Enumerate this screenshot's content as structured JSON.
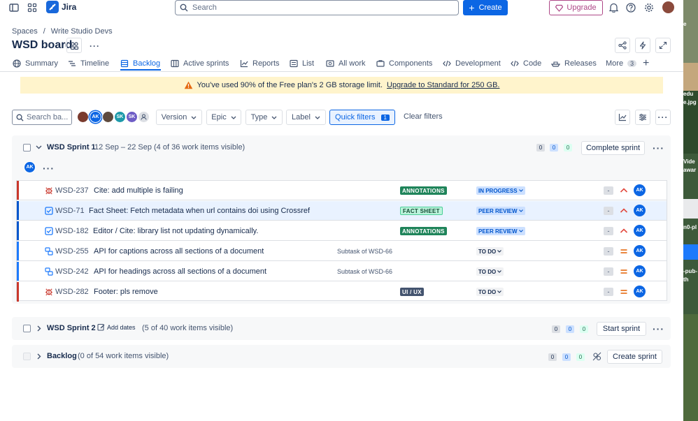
{
  "topbar": {
    "app_name": "Jira",
    "search_placeholder": "Search",
    "create_label": "Create",
    "upgrade_label": "Upgrade"
  },
  "header": {
    "breadcrumb": [
      "Spaces",
      "/",
      "Write Studio Devs"
    ],
    "title": "WSD board"
  },
  "tabs": [
    {
      "label": "Summary",
      "icon": "globe-icon"
    },
    {
      "label": "Timeline",
      "icon": "timeline-icon"
    },
    {
      "label": "Backlog",
      "icon": "backlog-icon",
      "active": true
    },
    {
      "label": "Active sprints",
      "icon": "board-icon"
    },
    {
      "label": "Reports",
      "icon": "chart-icon"
    },
    {
      "label": "List",
      "icon": "list-icon"
    },
    {
      "label": "All work",
      "icon": "all-work-icon"
    },
    {
      "label": "Components",
      "icon": "component-icon"
    },
    {
      "label": "Development",
      "icon": "code-icon"
    },
    {
      "label": "Code",
      "icon": "code-icon"
    },
    {
      "label": "Releases",
      "icon": "ship-icon"
    },
    {
      "label": "More",
      "icon": "",
      "count": "3"
    }
  ],
  "banner": {
    "text": "You've used 90% of the Free plan's 2 GB storage limit.",
    "link": "Upgrade to Standard for 250 GB."
  },
  "filters": {
    "search_placeholder": "Search ba...",
    "avatars": [
      "",
      "AK",
      "",
      "SK",
      "SK",
      ""
    ],
    "version": "Version",
    "epic": "Epic",
    "type": "Type",
    "label": "Label",
    "quick_filters": "Quick filters",
    "quick_filters_count": "1",
    "clear": "Clear filters"
  },
  "sprint1": {
    "name": "WSD Sprint 1",
    "meta": "12 Sep – 22 Sep (4 of 36 work items visible)",
    "counts": [
      "0",
      "0",
      "0"
    ],
    "action": "Complete sprint",
    "assignee": "AK",
    "issues": [
      {
        "type": "bug",
        "key": "WSD-237",
        "summary": "Cite: add multiple is failing",
        "parent": "",
        "label": "ANNOTATIONS",
        "label_style": "ann",
        "status": "IN PROGRESS",
        "status_style": "prog",
        "estimate": "-",
        "priority": "high",
        "assignee": "AK",
        "bar": "#c9372c"
      },
      {
        "type": "task",
        "key": "WSD-71",
        "summary": "Fact Sheet: Fetch metadata when url contains doi using Crossref",
        "parent": "",
        "label": "FACT SHEET",
        "label_style": "fact",
        "status": "PEER REVIEW",
        "status_style": "review",
        "estimate": "-",
        "priority": "high",
        "assignee": "AK",
        "bar": "#0055cc",
        "selected": true
      },
      {
        "type": "task",
        "key": "WSD-182",
        "summary": "Editor / Cite: library list not updating dynamically.",
        "parent": "",
        "label": "ANNOTATIONS",
        "label_style": "ann",
        "status": "PEER REVIEW",
        "status_style": "review",
        "estimate": "-",
        "priority": "high",
        "assignee": "AK",
        "bar": "#0055cc"
      },
      {
        "type": "subtask",
        "key": "WSD-255",
        "summary": "API for captions across all sections of a document",
        "parent": "Subtask of WSD-66",
        "label": "",
        "label_style": "",
        "status": "TO DO",
        "status_style": "todo",
        "estimate": "-",
        "priority": "medium",
        "assignee": "AK",
        "bar": "#1d7afc"
      },
      {
        "type": "subtask",
        "key": "WSD-242",
        "summary": "API for headings across all sections of a document",
        "parent": "Subtask of WSD-66",
        "label": "",
        "label_style": "",
        "status": "TO DO",
        "status_style": "todo",
        "estimate": "-",
        "priority": "medium",
        "assignee": "AK",
        "bar": "#1d7afc"
      },
      {
        "type": "bug",
        "key": "WSD-282",
        "summary": "Footer: pls remove",
        "parent": "",
        "label": "UI / UX",
        "label_style": "ux",
        "status": "TO DO",
        "status_style": "todo",
        "estimate": "-",
        "priority": "medium",
        "assignee": "AK",
        "bar": "#c9372c"
      }
    ]
  },
  "sprint2": {
    "name": "WSD Sprint 2",
    "add_dates": "Add dates",
    "meta": "(5 of 40 work items visible)",
    "counts": [
      "0",
      "0",
      "0"
    ],
    "action": "Start sprint"
  },
  "backlog": {
    "name": "Backlog",
    "meta": "(0 of 54 work items visible)",
    "counts": [
      "0",
      "0",
      "0"
    ],
    "action": "Create sprint"
  },
  "side_strip": {
    "texts": [
      "e",
      "edu",
      "e.jpg",
      "Vide",
      "awar",
      "n0-pl",
      "-pub-",
      "th"
    ]
  }
}
